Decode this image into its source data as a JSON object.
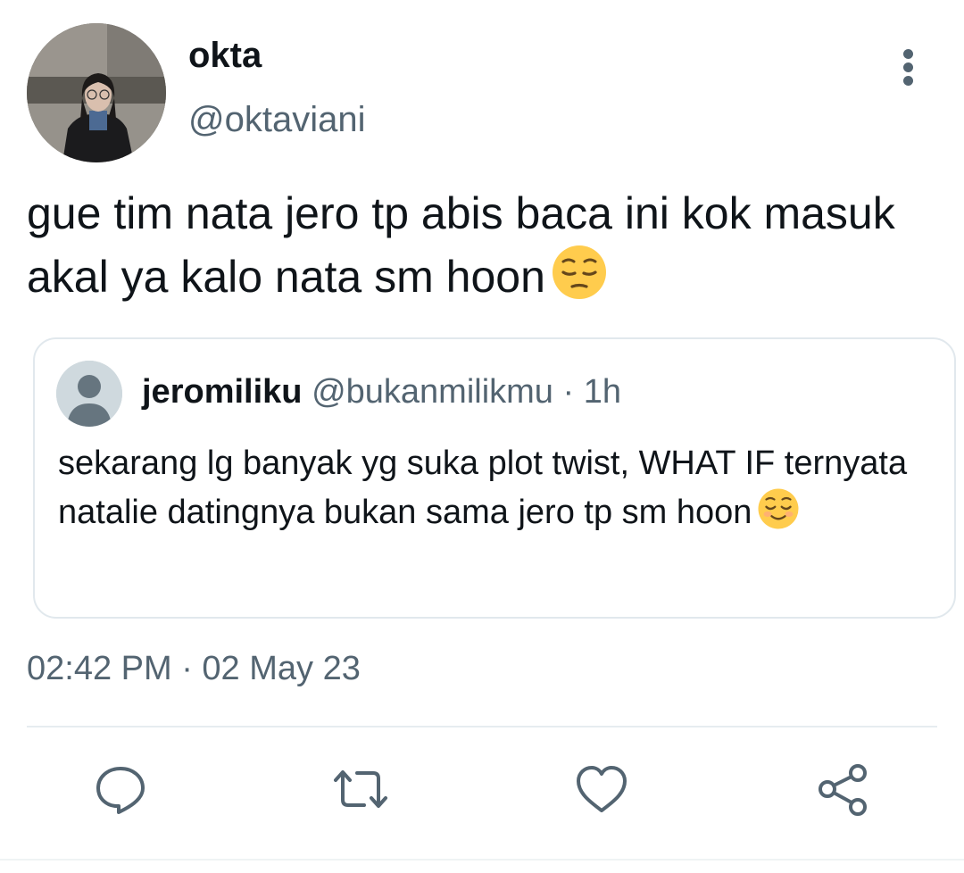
{
  "author": {
    "display_name": "okta",
    "handle": "@oktaviani"
  },
  "tweet": {
    "text": "gue tim nata jero tp abis baca ini kok masuk akal ya kalo nata sm hoon",
    "emoji": "pensive-face",
    "timestamp": "02:42 PM · 02 May 23"
  },
  "quoted": {
    "display_name": "jeromiliku",
    "handle": "@bukanmilikmu",
    "age": "· 1h",
    "text": "sekarang lg banyak yg suka plot twist, WHAT IF ternyata natalie datingnya bukan sama jero tp sm hoon",
    "emoji": "relieved-face"
  },
  "actions": {
    "reply_icon": "reply-icon",
    "retweet_icon": "retweet-icon",
    "like_icon": "heart-icon",
    "share_icon": "share-icon"
  },
  "colors": {
    "primary_text": "#0f1419",
    "secondary_text": "#536471",
    "border": "#e1e8ed",
    "emoji_yellow": "#ffcc4d"
  }
}
